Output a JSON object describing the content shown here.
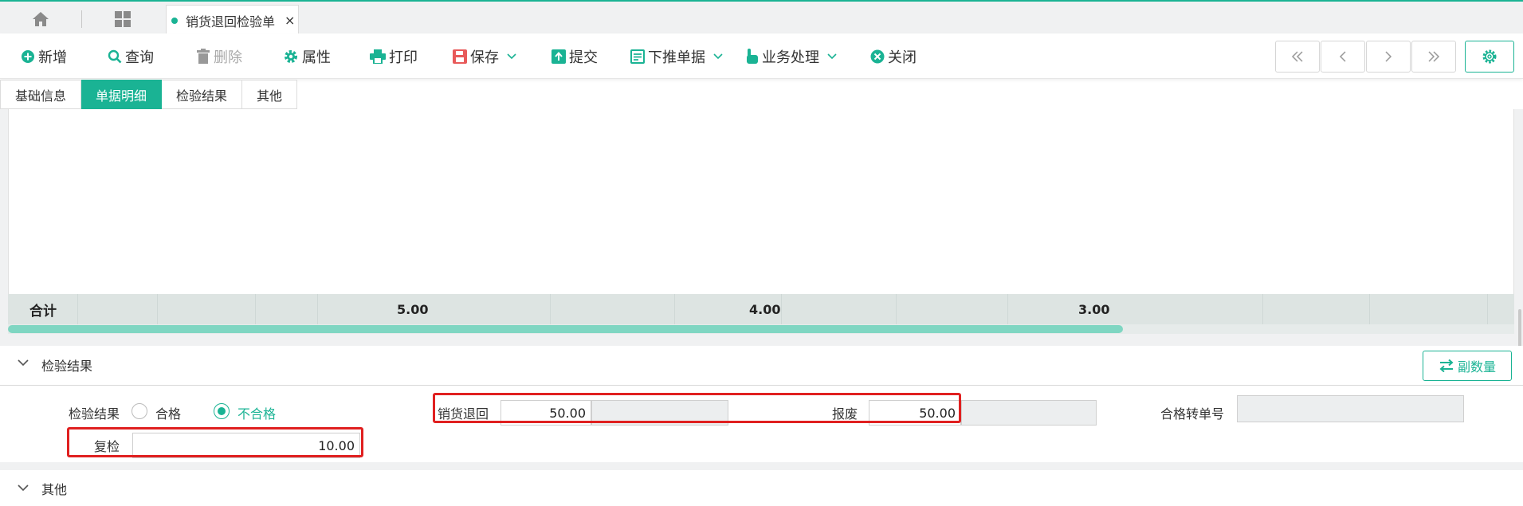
{
  "tabstrip": {
    "doc_tab_title": "销货退回检验单",
    "close_glyph": "×"
  },
  "toolbar": {
    "add": "新增",
    "query": "查询",
    "delete": "删除",
    "properties": "属性",
    "print": "打印",
    "save": "保存",
    "submit": "提交",
    "push_down": "下推单据",
    "business": "业务处理",
    "close": "关闭"
  },
  "section_tabs": [
    "基础信息",
    "单据明细",
    "检验结果",
    "其他"
  ],
  "grid": {
    "sum_label": "合计",
    "sum_values": [
      "5.00",
      "4.00",
      "3.00"
    ]
  },
  "inspection": {
    "section_title": "检验结果",
    "aux_qty_button": "副数量",
    "result_label": "检验结果",
    "radio_pass": "合格",
    "radio_fail": "不合格",
    "selected": "不合格",
    "sales_return_label": "销货退回",
    "sales_return_value": "50.00",
    "scrap_label": "报废",
    "scrap_value": "50.00",
    "pass_transfer_label": "合格转单号",
    "pass_transfer_value": "",
    "recheck_label": "复检",
    "recheck_value": "10.00"
  },
  "other_section": {
    "title": "其他"
  },
  "colors": {
    "accent": "#1ab394",
    "highlight": "#e02020"
  }
}
